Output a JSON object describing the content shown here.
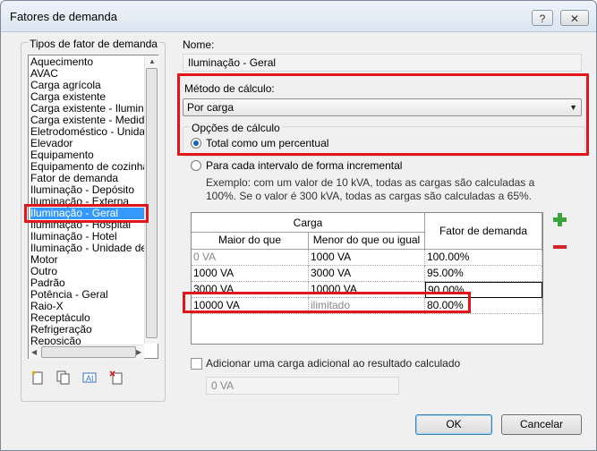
{
  "window": {
    "title": "Fatores de demanda",
    "help_label": "?",
    "close_label": "✕"
  },
  "types_panel": {
    "label": "Tipos de fator de demanda",
    "items": [
      "Aquecimento",
      "AVAC",
      "Carga agrícola",
      "Carga existente",
      "Carga existente - Iluminação",
      "Carga existente - Medidos p",
      "Eletrodoméstico - Unidade",
      "Elevador",
      "Equipamento",
      "Equipamento de cozinha -",
      "Fator de demanda",
      "Iluminação - Depósito",
      "Iluminação - Externa",
      "Iluminação - Geral",
      "Iluminação - Hospital",
      "Iluminação - Hotel",
      "Iluminação - Unidade de int",
      "Motor",
      "Outro",
      "Padrão",
      "Potência - Geral",
      "Raio-X",
      "Receptáculo",
      "Refrigeração",
      "Reposição"
    ],
    "selected_index": 13,
    "tools": [
      "new-icon",
      "duplicate-icon",
      "rename-icon",
      "delete-icon"
    ]
  },
  "name": {
    "label": "Nome:",
    "value": "Iluminação - Geral"
  },
  "method": {
    "label": "Método de cálculo:",
    "value": "Por carga"
  },
  "options": {
    "group_label": "Opções de cálculo",
    "radio_total": "Total como um percentual",
    "radio_incremental": "Para cada intervalo de forma incremental",
    "selected": "total",
    "example": "Exemplo: com um valor de 10 kVA, todas as cargas são calculadas a 100%. Se o valor é 300 kVA, todas as cargas são calculadas a 65%."
  },
  "table": {
    "group_header": "Carga",
    "col_greater": "Maior do que",
    "col_less": "Menor do que ou igual",
    "col_factor": "Fator de demanda",
    "rows": [
      {
        "greater": "0 VA",
        "less": "1000 VA",
        "factor": "100.00%"
      },
      {
        "greater": "1000 VA",
        "less": "3000 VA",
        "factor": "95.00%"
      },
      {
        "greater": "3000 VA",
        "less": "10000 VA",
        "factor": "90.00%"
      },
      {
        "greater": "10000 VA",
        "less": "ilimitado",
        "factor": "80.00%"
      }
    ]
  },
  "additional_load": {
    "label": "Adicionar uma carga adicional ao resultado calculado",
    "value": "0 VA",
    "checked": false
  },
  "buttons": {
    "ok": "OK",
    "cancel": "Cancelar"
  }
}
